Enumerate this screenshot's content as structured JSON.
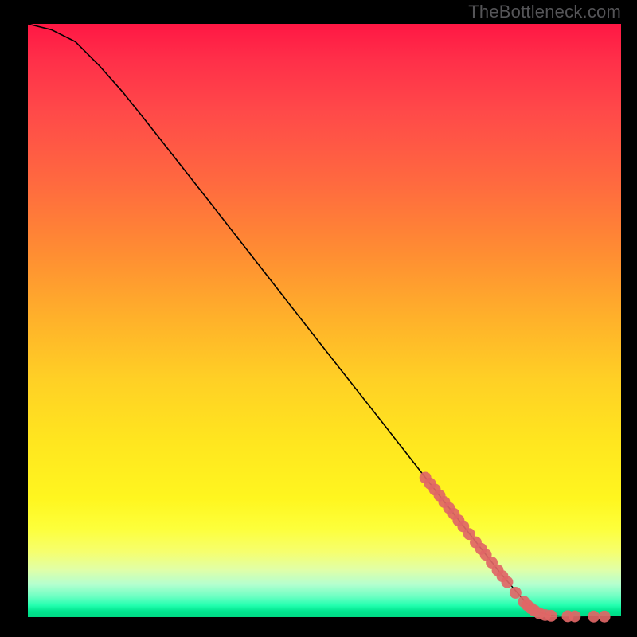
{
  "watermark": "TheBottleneck.com",
  "colors": {
    "marker": "#e06666",
    "curve": "#000000",
    "page_bg": "#000000"
  },
  "chart_data": {
    "type": "line",
    "title": "",
    "xlabel": "",
    "ylabel": "",
    "x_range": [
      0,
      100
    ],
    "y_range": [
      0,
      100
    ],
    "curve": [
      {
        "x": 0,
        "y": 100
      },
      {
        "x": 4,
        "y": 99
      },
      {
        "x": 8,
        "y": 97
      },
      {
        "x": 12,
        "y": 93
      },
      {
        "x": 16,
        "y": 88.5
      },
      {
        "x": 20,
        "y": 83.5
      },
      {
        "x": 30,
        "y": 70.8
      },
      {
        "x": 40,
        "y": 58
      },
      {
        "x": 50,
        "y": 45.2
      },
      {
        "x": 60,
        "y": 32.5
      },
      {
        "x": 70,
        "y": 19.7
      },
      {
        "x": 80,
        "y": 7.0
      },
      {
        "x": 84,
        "y": 2.4
      },
      {
        "x": 86,
        "y": 0.9
      },
      {
        "x": 88,
        "y": 0.3
      },
      {
        "x": 90,
        "y": 0.15
      },
      {
        "x": 95,
        "y": 0.1
      },
      {
        "x": 100,
        "y": 0.1
      }
    ],
    "markers": [
      {
        "x": 67.0,
        "y": 23.5,
        "r": 1.0
      },
      {
        "x": 67.8,
        "y": 22.5,
        "r": 1.0
      },
      {
        "x": 68.6,
        "y": 21.5,
        "r": 1.0
      },
      {
        "x": 69.4,
        "y": 20.5,
        "r": 1.0
      },
      {
        "x": 70.2,
        "y": 19.4,
        "r": 1.0
      },
      {
        "x": 71.0,
        "y": 18.4,
        "r": 1.0
      },
      {
        "x": 71.8,
        "y": 17.4,
        "r": 1.0
      },
      {
        "x": 72.6,
        "y": 16.3,
        "r": 1.0
      },
      {
        "x": 73.4,
        "y": 15.3,
        "r": 1.0
      },
      {
        "x": 74.4,
        "y": 14.0,
        "r": 1.0
      },
      {
        "x": 75.5,
        "y": 12.6,
        "r": 1.0
      },
      {
        "x": 76.4,
        "y": 11.5,
        "r": 1.0
      },
      {
        "x": 77.2,
        "y": 10.5,
        "r": 1.0
      },
      {
        "x": 78.2,
        "y": 9.2,
        "r": 1.0
      },
      {
        "x": 79.2,
        "y": 7.9,
        "r": 1.0
      },
      {
        "x": 80.0,
        "y": 6.9,
        "r": 1.0
      },
      {
        "x": 80.8,
        "y": 5.9,
        "r": 1.0
      },
      {
        "x": 82.2,
        "y": 4.1,
        "r": 1.0
      },
      {
        "x": 83.6,
        "y": 2.6,
        "r": 1.0
      },
      {
        "x": 84.2,
        "y": 2.0,
        "r": 1.0
      },
      {
        "x": 84.8,
        "y": 1.5,
        "r": 1.0
      },
      {
        "x": 85.4,
        "y": 1.1,
        "r": 1.0
      },
      {
        "x": 86.2,
        "y": 0.65,
        "r": 1.0
      },
      {
        "x": 87.2,
        "y": 0.35,
        "r": 1.0
      },
      {
        "x": 88.2,
        "y": 0.22,
        "r": 1.0
      },
      {
        "x": 91.0,
        "y": 0.15,
        "r": 1.0
      },
      {
        "x": 92.2,
        "y": 0.13,
        "r": 1.0
      },
      {
        "x": 95.4,
        "y": 0.1,
        "r": 1.0
      },
      {
        "x": 97.2,
        "y": 0.1,
        "r": 1.0
      }
    ]
  }
}
